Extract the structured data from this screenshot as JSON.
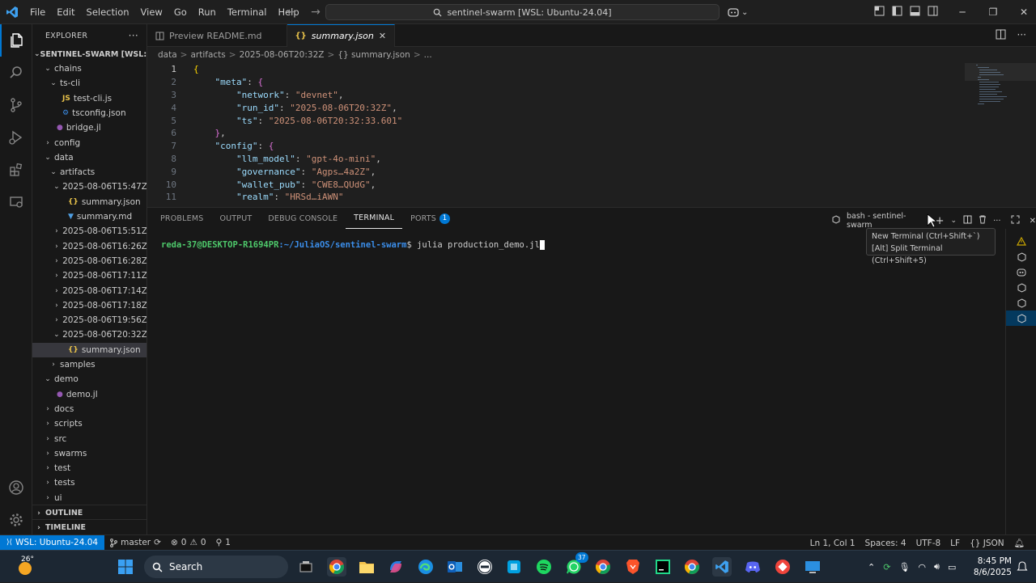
{
  "window": {
    "title": "sentinel-swarm [WSL: Ubuntu-24.04]",
    "menu": [
      "File",
      "Edit",
      "Selection",
      "View",
      "Go",
      "Run",
      "Terminal",
      "Help"
    ]
  },
  "sidebar": {
    "title": "EXPLORER",
    "root": "SENTINEL-SWARM [WSL: ...",
    "tree": [
      {
        "label": "chains",
        "depth": 1,
        "type": "folder-open"
      },
      {
        "label": "ts-cli",
        "depth": 2,
        "type": "folder-open"
      },
      {
        "label": "test-cli.js",
        "depth": 3,
        "type": "js"
      },
      {
        "label": "tsconfig.json",
        "depth": 3,
        "type": "tsconfig"
      },
      {
        "label": "bridge.jl",
        "depth": 2,
        "type": "julia"
      },
      {
        "label": "config",
        "depth": 1,
        "type": "folder"
      },
      {
        "label": "data",
        "depth": 1,
        "type": "folder-open"
      },
      {
        "label": "artifacts",
        "depth": 2,
        "type": "folder-open"
      },
      {
        "label": "2025-08-06T15:47Z",
        "depth": 3,
        "type": "folder-open"
      },
      {
        "label": "summary.json",
        "depth": 4,
        "type": "json"
      },
      {
        "label": "summary.md",
        "depth": 4,
        "type": "md"
      },
      {
        "label": "2025-08-06T15:51Z",
        "depth": 3,
        "type": "folder"
      },
      {
        "label": "2025-08-06T16:26Z",
        "depth": 3,
        "type": "folder"
      },
      {
        "label": "2025-08-06T16:28Z",
        "depth": 3,
        "type": "folder"
      },
      {
        "label": "2025-08-06T17:11Z",
        "depth": 3,
        "type": "folder"
      },
      {
        "label": "2025-08-06T17:14Z",
        "depth": 3,
        "type": "folder"
      },
      {
        "label": "2025-08-06T17:18Z",
        "depth": 3,
        "type": "folder"
      },
      {
        "label": "2025-08-06T19:56Z",
        "depth": 3,
        "type": "folder"
      },
      {
        "label": "2025-08-06T20:32Z",
        "depth": 3,
        "type": "folder-open"
      },
      {
        "label": "summary.json",
        "depth": 4,
        "type": "json",
        "selected": true
      },
      {
        "label": "samples",
        "depth": 2,
        "type": "folder"
      },
      {
        "label": "demo",
        "depth": 1,
        "type": "folder-open"
      },
      {
        "label": "demo.jl",
        "depth": 2,
        "type": "julia"
      },
      {
        "label": "docs",
        "depth": 1,
        "type": "folder"
      },
      {
        "label": "scripts",
        "depth": 1,
        "type": "folder"
      },
      {
        "label": "src",
        "depth": 1,
        "type": "folder"
      },
      {
        "label": "swarms",
        "depth": 1,
        "type": "folder"
      },
      {
        "label": "test",
        "depth": 1,
        "type": "folder"
      },
      {
        "label": "tests",
        "depth": 1,
        "type": "folder"
      },
      {
        "label": "ui",
        "depth": 1,
        "type": "folder"
      }
    ],
    "outline": "OUTLINE",
    "timeline": "TIMELINE"
  },
  "tabs": [
    {
      "label": "Preview README.md",
      "active": false
    },
    {
      "label": "summary.json",
      "active": true
    }
  ],
  "breadcrumb": [
    "data",
    ">",
    "artifacts",
    ">",
    "2025-08-06T20:32Z",
    ">",
    "{} summary.json",
    ">",
    "..."
  ],
  "code": {
    "lines": [
      {
        "n": "1",
        "t": [
          [
            "b1",
            "{"
          ]
        ]
      },
      {
        "n": "2",
        "t": [
          [
            "p",
            "    "
          ],
          [
            "k",
            "\"meta\""
          ],
          [
            "p",
            ": "
          ],
          [
            "b2",
            "{"
          ]
        ]
      },
      {
        "n": "3",
        "t": [
          [
            "p",
            "        "
          ],
          [
            "k",
            "\"network\""
          ],
          [
            "p",
            ": "
          ],
          [
            "s",
            "\"devnet\""
          ],
          [
            "p",
            ","
          ]
        ]
      },
      {
        "n": "4",
        "t": [
          [
            "p",
            "        "
          ],
          [
            "k",
            "\"run_id\""
          ],
          [
            "p",
            ": "
          ],
          [
            "s",
            "\"2025-08-06T20:32Z\""
          ],
          [
            "p",
            ","
          ]
        ]
      },
      {
        "n": "5",
        "t": [
          [
            "p",
            "        "
          ],
          [
            "k",
            "\"ts\""
          ],
          [
            "p",
            ": "
          ],
          [
            "s",
            "\"2025-08-06T20:32:33.601\""
          ]
        ]
      },
      {
        "n": "6",
        "t": [
          [
            "p",
            "    "
          ],
          [
            "b2",
            "}"
          ],
          [
            "p",
            ","
          ]
        ]
      },
      {
        "n": "7",
        "t": [
          [
            "p",
            "    "
          ],
          [
            "k",
            "\"config\""
          ],
          [
            "p",
            ": "
          ],
          [
            "b2",
            "{"
          ]
        ]
      },
      {
        "n": "8",
        "t": [
          [
            "p",
            "        "
          ],
          [
            "k",
            "\"llm_model\""
          ],
          [
            "p",
            ": "
          ],
          [
            "s",
            "\"gpt-4o-mini\""
          ],
          [
            "p",
            ","
          ]
        ]
      },
      {
        "n": "9",
        "t": [
          [
            "p",
            "        "
          ],
          [
            "k",
            "\"governance\""
          ],
          [
            "p",
            ": "
          ],
          [
            "s",
            "\"Agps…4a2Z\""
          ],
          [
            "p",
            ","
          ]
        ]
      },
      {
        "n": "10",
        "t": [
          [
            "p",
            "        "
          ],
          [
            "k",
            "\"wallet_pub\""
          ],
          [
            "p",
            ": "
          ],
          [
            "s",
            "\"CWE8…QUdG\""
          ],
          [
            "p",
            ","
          ]
        ]
      },
      {
        "n": "11",
        "t": [
          [
            "p",
            "        "
          ],
          [
            "k",
            "\"realm\""
          ],
          [
            "p",
            ": "
          ],
          [
            "s",
            "\"HRSd…iAWN\""
          ]
        ]
      }
    ]
  },
  "panel": {
    "tabs": [
      "PROBLEMS",
      "OUTPUT",
      "DEBUG CONSOLE",
      "TERMINAL",
      "PORTS"
    ],
    "ports_badge": "1",
    "terminal_name": "bash - sentinel-swarm",
    "prompt_user": "reda-37@DESKTOP-R1694PR",
    "prompt_path": ":~/JuliaOS/sentinel-swarm",
    "command": "$ julia production_demo.jl",
    "tooltip_line1": "New Terminal (Ctrl+Shift+`)",
    "tooltip_line2": "[Alt] Split Terminal (Ctrl+Shift+5)"
  },
  "statusbar": {
    "remote": "WSL: Ubuntu-24.04",
    "branch": "master",
    "errors": "0",
    "warnings": "0",
    "ports": "1",
    "position": "Ln 1, Col 1",
    "spaces": "Spaces: 4",
    "encoding": "UTF-8",
    "eol": "LF",
    "language": "{} JSON"
  },
  "taskbar": {
    "weather_temp": "26°",
    "search": "Search",
    "tray_badge": "37",
    "time": "8:45 PM",
    "date": "8/6/2025"
  },
  "colors": {
    "accent": "#0078d4",
    "json_key": "#9cdcfe",
    "json_string": "#ce9178",
    "prompt_user": "#4ec96b",
    "prompt_path": "#3b8eea"
  }
}
